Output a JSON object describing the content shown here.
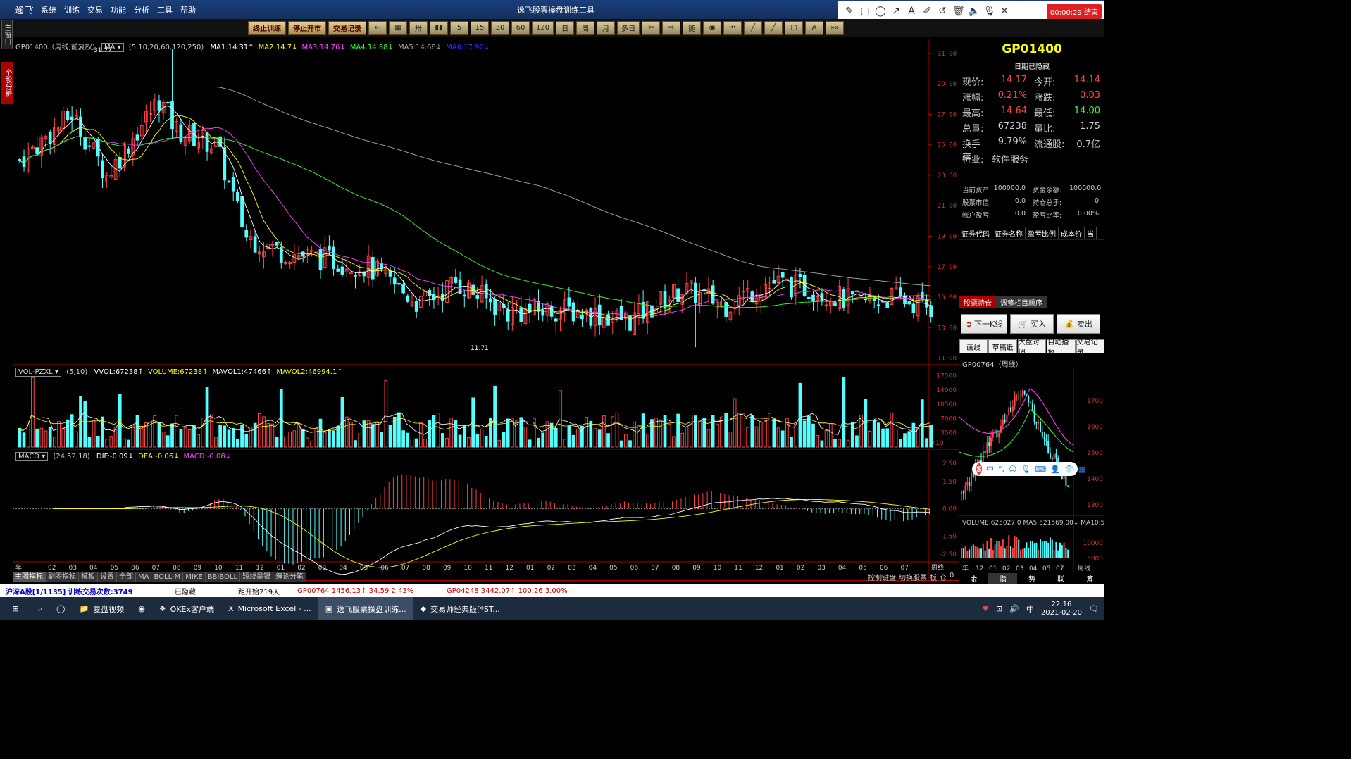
{
  "app": {
    "logo": "逸飞",
    "title": "逸飞股票操盘训练工具",
    "menus": [
      "系统",
      "训练",
      "交易",
      "功能",
      "分析",
      "工具",
      "帮助"
    ],
    "recording": "00:00:29 结束"
  },
  "sidebar": {
    "tab1": "主窗口",
    "tab2": "个股分析"
  },
  "toolbar": {
    "buttons_primary": [
      "终止训练",
      "停止开市",
      "交易记录"
    ],
    "buttons": [
      "←",
      "▦",
      "卅",
      "▮▮",
      "5",
      "15",
      "30",
      "60",
      "120",
      "日",
      "周",
      "月",
      "多日",
      "⇦",
      "⇨",
      "随",
      "◉",
      "⏮",
      "╱",
      "╱",
      "▢",
      "A",
      "»»"
    ]
  },
  "main": {
    "header_code": "GP01400（周线,前复权）",
    "ma_selector": "MA",
    "ma_params": "(5,10,20,60,120,250)",
    "ma": [
      {
        "label": "MA1:14.31↑",
        "color": "#ffffff"
      },
      {
        "label": "MA2:14.7↓",
        "color": "#ffff00"
      },
      {
        "label": "MA3:14.76↓",
        "color": "#ff44ff"
      },
      {
        "label": "MA4:14.88↓",
        "color": "#33ff33"
      },
      {
        "label": "MA5:14.66↓",
        "color": "#aaaaaa"
      },
      {
        "label": "MA6:17.90↓",
        "color": "#3333ff"
      }
    ],
    "y_ticks": [
      "31.00",
      "29.00",
      "27.00",
      "25.00",
      "23.00",
      "21.00",
      "19.00",
      "17.00",
      "15.00",
      "13.00",
      "11.00"
    ],
    "high_label": "31.27",
    "low_label": "11.71"
  },
  "vol": {
    "selector": "VOL-PZXL",
    "params": "(5,10)",
    "items": [
      {
        "label": "VVOL:67238↑",
        "color": "#ffffff"
      },
      {
        "label": "VOLUME:67238↑",
        "color": "#ffff00"
      },
      {
        "label": "MAVOL1:47466↑",
        "color": "#ffffff"
      },
      {
        "label": "MAVOL2:46994.1↑",
        "color": "#ffff00"
      }
    ],
    "y_ticks": [
      "17500",
      "14000",
      "10500",
      "7000",
      "3500"
    ],
    "unit": "X10"
  },
  "macd": {
    "selector": "MACD",
    "params": "(24,52,18)",
    "items": [
      {
        "label": "DIF:-0.09↓",
        "color": "#ffffff"
      },
      {
        "label": "DEA:-0.06↓",
        "color": "#ffff00"
      },
      {
        "label": "MACD:-0.08↓",
        "color": "#ff44ff"
      }
    ],
    "y_ticks": [
      "2.50",
      "1.50",
      "0.00",
      "-1.50",
      "-2.50"
    ]
  },
  "xaxis": {
    "first": "年",
    "labels": [
      "02",
      "03",
      "04",
      "05",
      "06",
      "07",
      "08",
      "09",
      "10",
      "11",
      "12",
      "01",
      "02",
      "03",
      "04",
      "05",
      "06",
      "07",
      "08",
      "09",
      "10",
      "11",
      "12",
      "01",
      "02",
      "03",
      "04",
      "05",
      "06",
      "07",
      "08",
      "09",
      "10",
      "11",
      "12",
      "01",
      "02",
      "03",
      "04",
      "05",
      "06",
      "07"
    ],
    "period": "周线"
  },
  "quote": {
    "code": "GP01400",
    "date_note": "日期已隐藏",
    "rows": [
      {
        "l1": "现价:",
        "v1": "14.17",
        "c1": "#ff4444",
        "l2": "今开:",
        "v2": "14.14",
        "c2": "#ff4444"
      },
      {
        "l1": "涨幅:",
        "v1": "0.21%",
        "c1": "#ff4444",
        "l2": "涨跌:",
        "v2": "0.03",
        "c2": "#ff4444"
      },
      {
        "l1": "最高:",
        "v1": "14.64",
        "c1": "#ff4444",
        "l2": "最低:",
        "v2": "14.00",
        "c2": "#33ff33"
      },
      {
        "l1": "总量:",
        "v1": "67238",
        "c1": "#cccccc",
        "l2": "量比:",
        "v2": "1.75",
        "c2": "#cccccc"
      },
      {
        "l1": "换手率:",
        "v1": "9.79%",
        "c1": "#cccccc",
        "l2": "流通股:",
        "v2": "0.7亿",
        "c2": "#cccccc"
      }
    ],
    "industry_label": "行业:",
    "industry": "软件服务"
  },
  "account": [
    {
      "a": "当前资产:",
      "b": "100000.0",
      "c": "资金余额:",
      "d": "100000.0"
    },
    {
      "a": "股票市值:",
      "b": "0.0",
      "c": "持仓总手:",
      "d": "0"
    },
    {
      "a": "帐户盈亏:",
      "b": "0.0",
      "c": "盈亏比率:",
      "d": "0.00%"
    }
  ],
  "positions": {
    "headers": [
      "证券代码",
      "证券名称",
      "盈亏比例",
      "成本价",
      "当"
    ],
    "tabs": [
      "股票持仓",
      "调整栏目顺序"
    ]
  },
  "actions": {
    "next": "下一K线",
    "buy": "买入",
    "sell": "卖出",
    "tools": [
      "画线",
      "草稿纸",
      "大盘对照",
      "自动播放",
      "交易记录"
    ]
  },
  "mini": {
    "header": "GP00764（周线）",
    "y_ticks": [
      "1700",
      "1600",
      "1500",
      "1400",
      "1300"
    ],
    "vol_header": "VOLUME:625027.0 MA5:521569.00↓ MA10:53120",
    "vol_ticks": [
      "10000",
      "5000"
    ],
    "x_labels": [
      "年",
      "12",
      "01",
      "02",
      "03",
      "04",
      "05",
      "07"
    ],
    "period": "周线",
    "tabs": [
      "金",
      "指",
      "势",
      "联",
      "筹"
    ]
  },
  "bottom_tabs": [
    "主图指标",
    "副图指标",
    "模板",
    "设置",
    "全部",
    "MA",
    "BOLL-M",
    "MIKE",
    "BBIBOLL",
    "短线是银",
    "缠论分笔"
  ],
  "bottom_right": [
    "控制键盘",
    "切换股票",
    "板",
    "仓",
    "0"
  ],
  "status": [
    {
      "t": "沪深A股[1/1135] 训练交易次数:3749",
      "c": "#0000cc"
    },
    {
      "t": "已隐藏",
      "c": "#000000"
    },
    {
      "t": "距开始219天",
      "c": "#000000"
    },
    {
      "t": "GP00764 1456.13↑ 34.59 2.43%",
      "c": "#cc0000"
    },
    {
      "t": "GP04248 3442.07↑ 100.26 3.00%",
      "c": "#cc0000"
    }
  ],
  "taskbar": {
    "items": [
      "复盘视频",
      "",
      "OKEx客户端",
      "Microsoft Excel - ...",
      "逸飞股票操盘训练...",
      "交易师经典版[*ST..."
    ],
    "time": "22:16",
    "date": "2021-02-20"
  }
}
